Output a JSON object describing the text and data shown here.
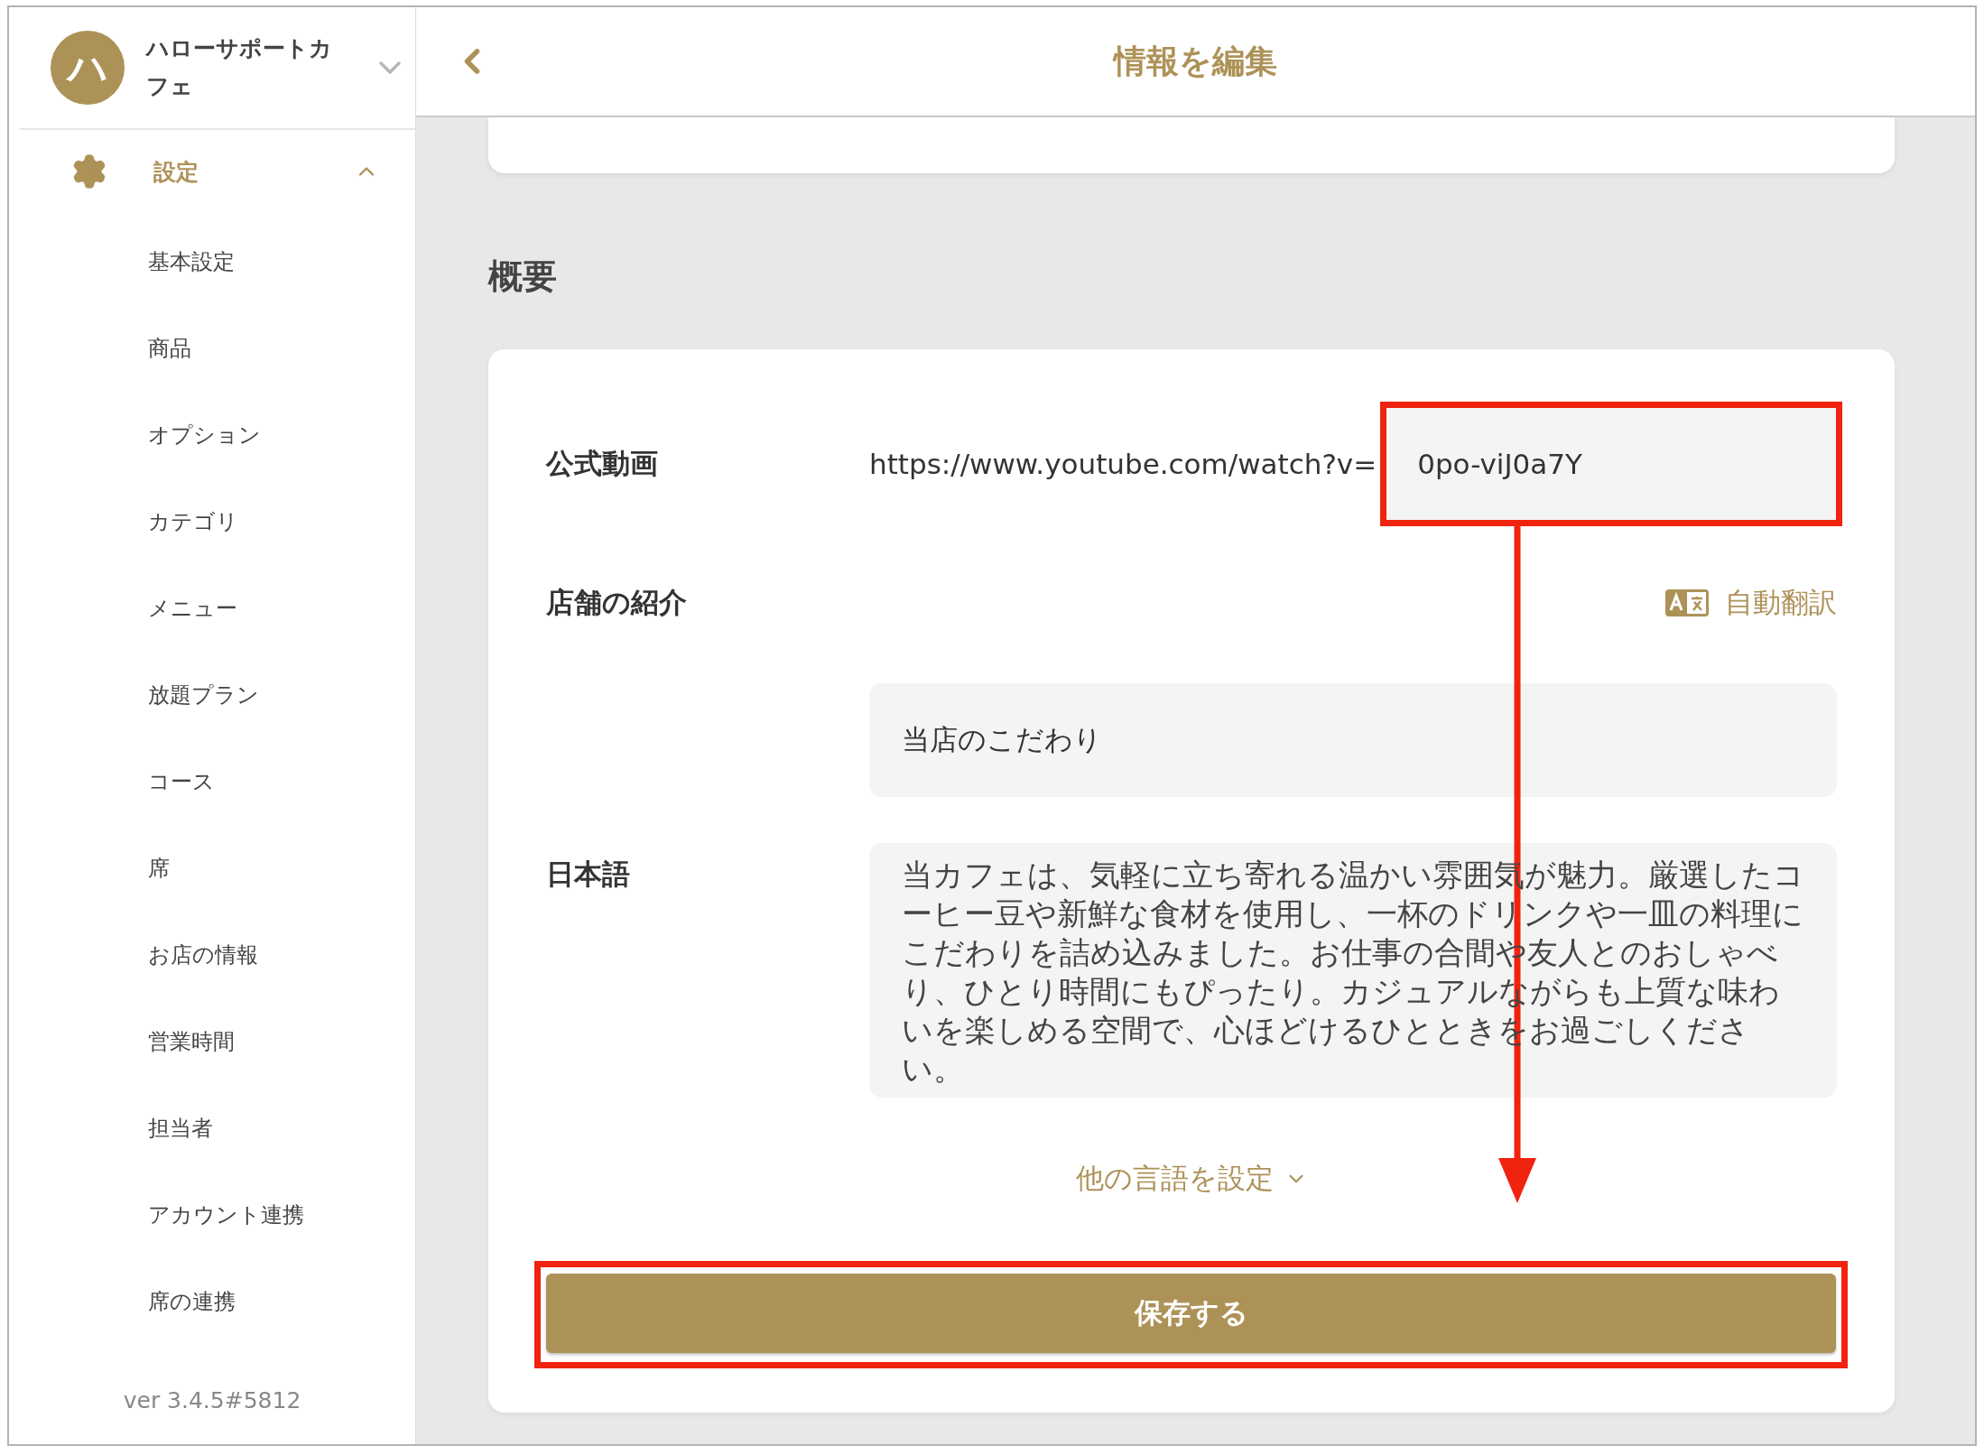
{
  "sidebar": {
    "avatar_letter": "ハ",
    "shop_name": "ハローサポートカフェ",
    "section": {
      "label": "設定",
      "expanded": true
    },
    "items": [
      "基本設定",
      "商品",
      "オプション",
      "カテゴリ",
      "メニュー",
      "放題プラン",
      "コース",
      "席",
      "お店の情報",
      "営業時間",
      "担当者",
      "アカウント連携",
      "席の連携"
    ],
    "version": "ver 3.4.5#5812"
  },
  "header": {
    "title": "情報を編集"
  },
  "section_title": "概要",
  "form": {
    "video": {
      "label": "公式動画",
      "url_prefix": "https://www.youtube.com/watch?v=",
      "value": "0po-viJ0a7Y",
      "highlighted": true
    },
    "intro": {
      "label": "店舗の紹介",
      "auto_translate": "自動翻訳",
      "title_value": "当店のこだわり",
      "language_label": "日本語",
      "body": "当カフェは、気軽に立ち寄れる温かい雰囲気が魅力。厳選したコーヒー豆や新鮮な食材を使用し、一杯のドリンクや一皿の料理にこだわりを詰め込みました。お仕事の合間や友人とのおしゃべり、ひとり時間にもぴったり。カジュアルながらも上質な味わいを楽しめる空間で、心ほどけるひとときをお過ごしください。"
    },
    "other_languages": {
      "label": "他の言語を設定",
      "expanded": false
    },
    "save": {
      "label": "保存する",
      "highlighted": true
    }
  },
  "annotation": {
    "arrow": true
  }
}
